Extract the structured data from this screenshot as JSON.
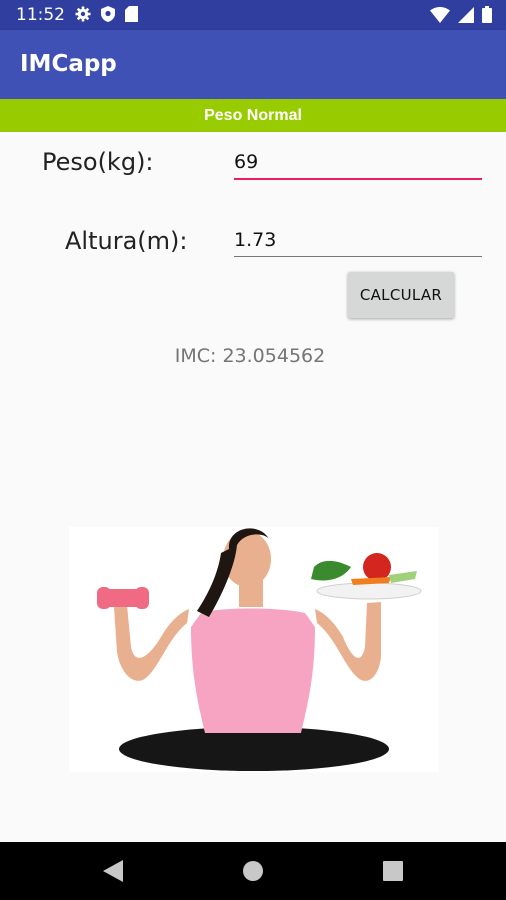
{
  "status_bar": {
    "time": "11:52",
    "left_icons": [
      "gear-icon",
      "shield-icon",
      "sd-card-icon"
    ],
    "right_icons": [
      "wifi-icon",
      "cellular-signal-icon",
      "battery-icon"
    ]
  },
  "app_bar": {
    "title": "IMCapp"
  },
  "result_banner": {
    "text": "Peso Normal",
    "color": "#99cc00"
  },
  "form": {
    "peso_label": "Peso(kg):",
    "peso_value": "69",
    "altura_label": "Altura(m):",
    "altura_value": "1.73",
    "calculate_button": "CALCULAR"
  },
  "result": {
    "imc_text": "IMC: 23.054562"
  },
  "image": {
    "description_icon": "fitness-woman-image"
  },
  "nav_bar": {
    "buttons": [
      "back-icon",
      "home-icon",
      "recents-icon"
    ]
  },
  "colors": {
    "status_bar": "#303f9f",
    "app_bar": "#3f51b5",
    "accent": "#e91e63",
    "banner": "#99cc00"
  }
}
